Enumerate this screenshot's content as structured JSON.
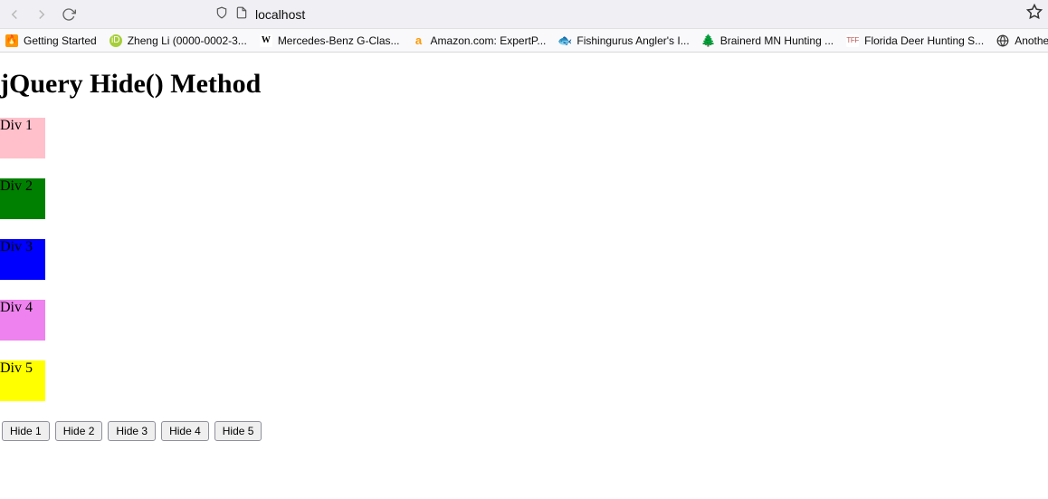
{
  "browser": {
    "url": "localhost"
  },
  "bookmarks": [
    {
      "label": "Getting Started"
    },
    {
      "label": "Zheng Li (0000-0002-3..."
    },
    {
      "label": "Mercedes-Benz G-Clas..."
    },
    {
      "label": "Amazon.com: ExpertP..."
    },
    {
      "label": "Fishingurus Angler's I..."
    },
    {
      "label": "Brainerd MN Hunting ..."
    },
    {
      "label": "Florida Deer Hunting S..."
    },
    {
      "label": "Another res"
    }
  ],
  "page": {
    "heading": "jQuery Hide() Method",
    "divs": [
      {
        "label": "Div 1",
        "color": "#ffc0cb"
      },
      {
        "label": "Div 2",
        "color": "#008000"
      },
      {
        "label": "Div 3",
        "color": "#0000ff"
      },
      {
        "label": "Div 4",
        "color": "#ee82ee"
      },
      {
        "label": "Div 5",
        "color": "#ffff00"
      }
    ],
    "buttons": [
      {
        "label": "Hide 1"
      },
      {
        "label": "Hide 2"
      },
      {
        "label": "Hide 3"
      },
      {
        "label": "Hide 4"
      },
      {
        "label": "Hide 5"
      }
    ]
  }
}
